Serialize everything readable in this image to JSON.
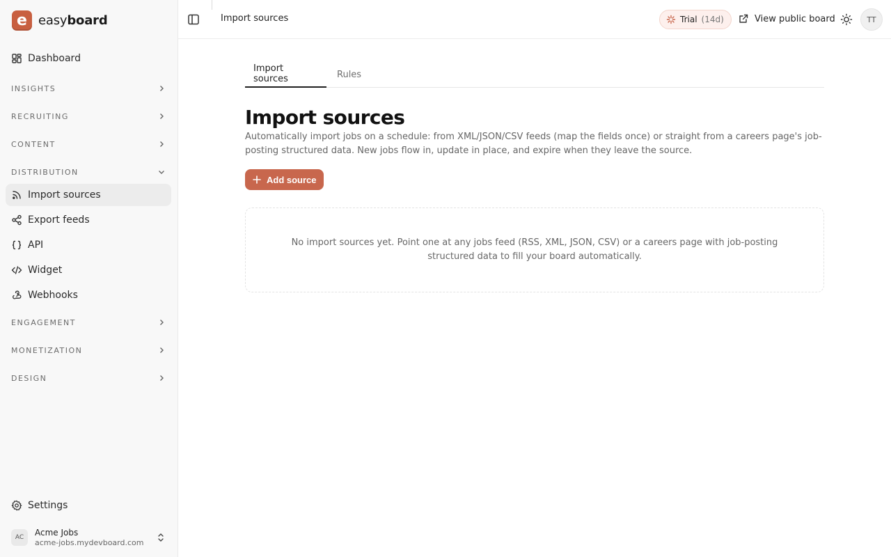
{
  "brand": {
    "logo_letter": "e",
    "name_light": "easy",
    "name_bold": "board"
  },
  "sidebar": {
    "dashboard": {
      "label": "Dashboard",
      "icon": "dashboard-icon"
    },
    "sections": {
      "insights": "INSIGHTS",
      "recruiting": "RECRUITING",
      "content": "CONTENT",
      "distribution": "DISTRIBUTION",
      "engagement": "ENGAGEMENT",
      "monetization": "MONETIZATION",
      "design": "DESIGN"
    },
    "distribution_items": [
      {
        "label": "Import sources",
        "icon": "rss-icon",
        "active": true
      },
      {
        "label": "Export feeds",
        "icon": "share-icon"
      },
      {
        "label": "API",
        "icon": "braces-icon"
      },
      {
        "label": "Widget",
        "icon": "code-icon"
      },
      {
        "label": "Webhooks",
        "icon": "webhook-icon"
      }
    ],
    "settings": {
      "label": "Settings",
      "icon": "gear-icon"
    },
    "account": {
      "initials": "AC",
      "name": "Acme Jobs",
      "domain": "acme-jobs.mydevboard.com"
    }
  },
  "header": {
    "title": "Import sources",
    "trial_label": "Trial",
    "trial_days": "(14d)",
    "view_public_label": "View public board",
    "user_initials": "TT"
  },
  "main": {
    "tabs": [
      "Import sources",
      "Rules"
    ],
    "title": "Import sources",
    "description": "Automatically import jobs on a schedule: from XML/JSON/CSV feeds (map the fields once) or straight from a careers page's job-posting structured data. New jobs flow in, update in place, and expire when they leave the source.",
    "add_button": "Add source",
    "empty_message": "No import sources yet. Point one at any jobs feed (RSS, XML, JSON, CSV) or a careers page with job-posting structured data to fill your board automatically."
  },
  "colors": {
    "accent": "#c8674d",
    "sidebar_bg": "#f8f8f8",
    "active_item_bg": "#ececec"
  }
}
